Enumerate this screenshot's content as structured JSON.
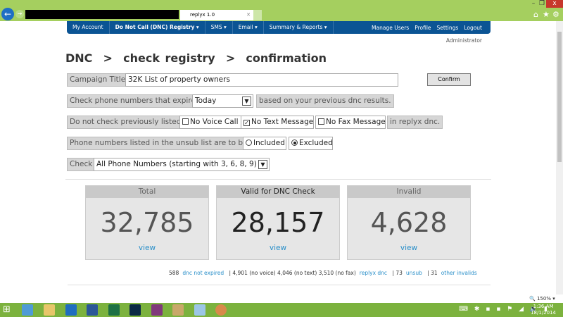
{
  "browser": {
    "tab_title": "replyx 1.0",
    "zoom": "150%"
  },
  "nav": {
    "items": [
      "My Account",
      "Do Not Call (DNC) Registry",
      "SMS",
      "Email",
      "Summary & Reports"
    ],
    "right": [
      "Manage Users",
      "Profile",
      "Settings",
      "Logout"
    ]
  },
  "user": "Administrator",
  "breadcrumb": "DNC  >  check registry  >  confirmation",
  "form": {
    "campaign_label": "Campaign Title",
    "campaign_value": "32K List of property owners",
    "confirm": "Confirm",
    "expire_label": "Check phone numbers that expire",
    "expire_value": "Today",
    "expire_suffix": "based on your previous dnc results.",
    "prev_label": "Do not check previously listed",
    "no_voice": "No Voice Call",
    "no_text": "No Text Message",
    "no_fax": "No Fax Message",
    "prev_suffix": "in replyx dnc.",
    "no_voice_checked": false,
    "no_text_checked": true,
    "no_fax_checked": false,
    "unsub_label": "Phone numbers listed in the unsub list are to be",
    "included": "Included",
    "excluded": "Excluded",
    "unsub_selected": "Excluded",
    "check_label": "Check",
    "check_value": "All Phone Numbers (starting with 3, 6, 8, 9)"
  },
  "cards": [
    {
      "title": "Total",
      "value": "32,785",
      "link": "view"
    },
    {
      "title": "Valid for DNC Check",
      "value": "28,157",
      "link": "view"
    },
    {
      "title": "Invalid",
      "value": "4,628",
      "link": "view"
    }
  ],
  "stats": {
    "n1": "588",
    "l1": "dnc not expired",
    "mid": "|  4,901 (no voice) 4,046 (no text) 3,510 (no fax)",
    "l2": "replyx dnc",
    "n3": "|  73",
    "l3": "unsub",
    "n4": "|  31",
    "l4": "other invalids"
  },
  "taskbar": {
    "time": "1:36 AM",
    "date": "18/1/2014"
  }
}
